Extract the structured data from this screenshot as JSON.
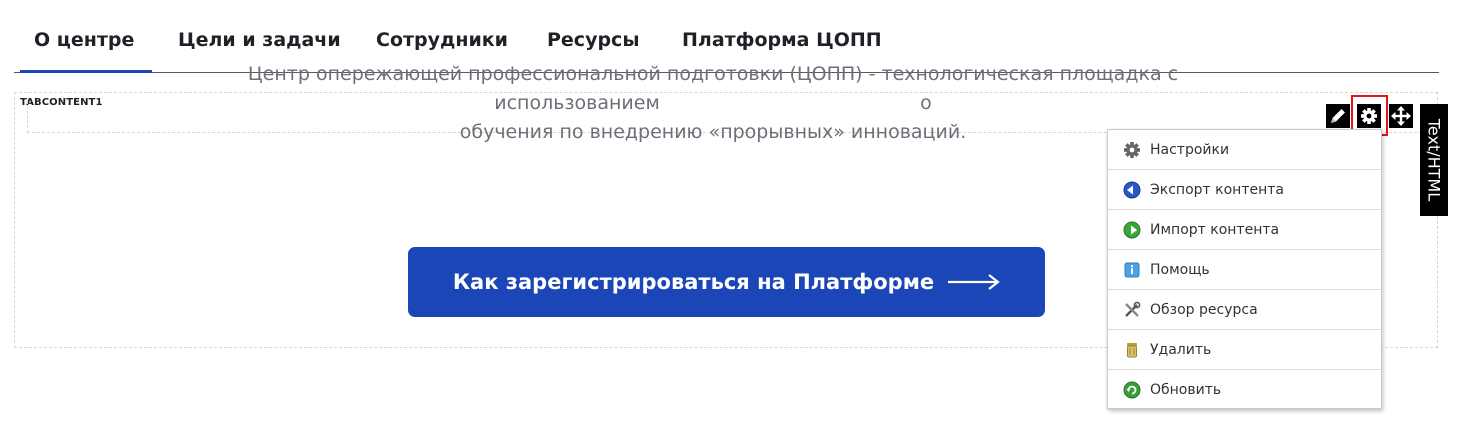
{
  "tabs": [
    {
      "label": "О центре",
      "active": true
    },
    {
      "label": "Цели и задачи"
    },
    {
      "label": "Сотрудники"
    },
    {
      "label": "Ресурсы"
    },
    {
      "label": "Платформа ЦОПП"
    }
  ],
  "content": {
    "block_label": "TABCONTENT1",
    "description_line1": "Центр опережающей профессиональной подготовки (ЦОПП) - технологическая площадка с использованием",
    "description_line2": "обучения по внедрению «прорывных» инноваций.",
    "description_tail": "о",
    "cta_label": "Как зарегистрироваться на Платформе"
  },
  "toolbar": {
    "edit_icon": "pencil-icon",
    "settings_icon": "gear-icon",
    "move_icon": "move-arrows-icon",
    "side_tab_label": "Text/HTML",
    "highlight_color": "#e0161b"
  },
  "menu": {
    "items": [
      {
        "label": "Настройки",
        "icon": "gear-icon"
      },
      {
        "label": "Экспорт контента",
        "icon": "export-icon"
      },
      {
        "label": "Импорт контента",
        "icon": "import-icon"
      },
      {
        "label": "Помощь",
        "icon": "help-icon"
      },
      {
        "label": "Обзор ресурса",
        "icon": "tools-icon"
      },
      {
        "label": "Удалить",
        "icon": "trash-icon"
      },
      {
        "label": "Обновить",
        "icon": "refresh-icon"
      }
    ]
  },
  "colors": {
    "accent": "#1b46b8",
    "text_muted": "#6b6f77",
    "tab_text": "#1f2126"
  }
}
